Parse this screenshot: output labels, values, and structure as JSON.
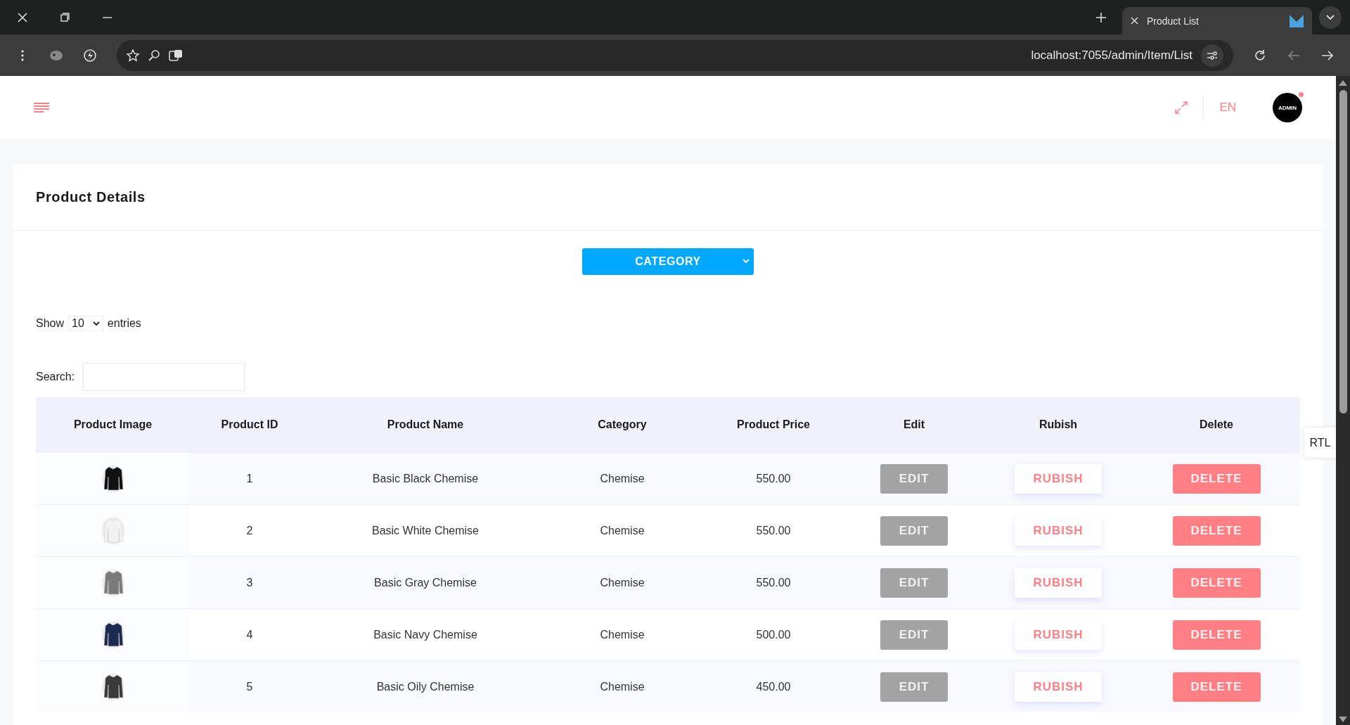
{
  "browser": {
    "tab_title": "Product List",
    "url": "localhost:7055/admin/Item/List"
  },
  "header": {
    "language": "EN",
    "language_selected": true,
    "avatar_label": "ADMIN",
    "notification": true
  },
  "card": {
    "title": "Product Details",
    "category_button": "CATEGORY",
    "show_label": "Show",
    "page_size": "10",
    "entries_label": "entries",
    "search_label": "Search:"
  },
  "table": {
    "columns": [
      "Product Image",
      "Product ID",
      "Product Name",
      "Category",
      "Product Price",
      "Edit",
      "Rubish",
      "Delete"
    ],
    "rows": [
      {
        "color": "#111111",
        "id": "1",
        "name": "Basic Black Chemise",
        "category": "Chemise",
        "price": "550.00",
        "edit": "EDIT",
        "rubish": "RUBISH",
        "delete": "DELETE"
      },
      {
        "color": "#f2f2f2",
        "id": "2",
        "name": "Basic White Chemise",
        "category": "Chemise",
        "price": "550.00",
        "edit": "EDIT",
        "rubish": "RUBISH",
        "delete": "DELETE"
      },
      {
        "color": "#7a7a7a",
        "id": "3",
        "name": "Basic Gray Chemise",
        "category": "Chemise",
        "price": "550.00",
        "edit": "EDIT",
        "rubish": "RUBISH",
        "delete": "DELETE"
      },
      {
        "color": "#1b2a4e",
        "id": "4",
        "name": "Basic Navy Chemise",
        "category": "Chemise",
        "price": "500.00",
        "edit": "EDIT",
        "rubish": "RUBISH",
        "delete": "DELETE"
      },
      {
        "color": "#3a3a3a",
        "id": "5",
        "name": "Basic Oily Chemise",
        "category": "Chemise",
        "price": "450.00",
        "edit": "EDIT",
        "rubish": "RUBISH",
        "delete": "DELETE"
      }
    ]
  },
  "rtl_toggle": "RTL"
}
